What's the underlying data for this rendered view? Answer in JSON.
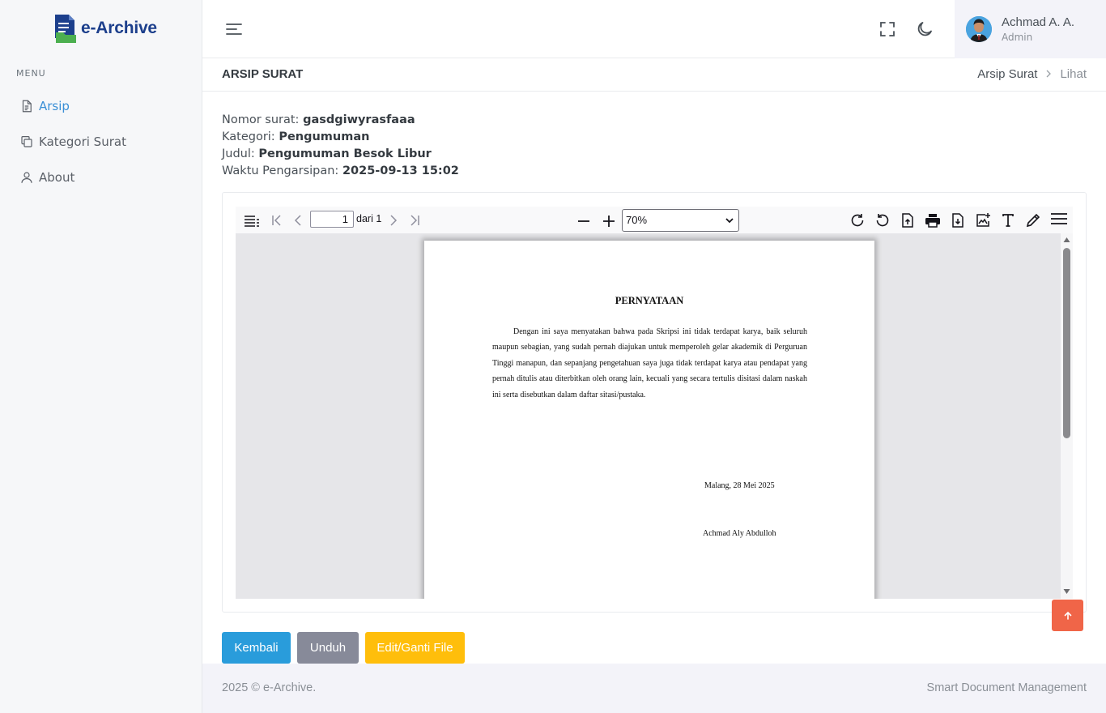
{
  "app": {
    "name": "e-Archive"
  },
  "sidebar": {
    "menu_title": "MENU",
    "items": [
      {
        "label": "Arsip",
        "icon": "document-icon",
        "active": true
      },
      {
        "label": "Kategori Surat",
        "icon": "copy-icon",
        "active": false
      },
      {
        "label": "About",
        "icon": "user-icon",
        "active": false
      }
    ]
  },
  "topbar": {
    "user_name": "Achmad A. A.",
    "user_role": "Admin"
  },
  "page": {
    "title": "ARSIP SURAT",
    "breadcrumb": [
      "Arsip Surat",
      "Lihat"
    ]
  },
  "meta": {
    "nomor_label": "Nomor surat:",
    "nomor_value": "gasdgiwyrasfaaa",
    "kategori_label": "Kategori:",
    "kategori_value": "Pengumuman",
    "judul_label": "Judul:",
    "judul_value": "Pengumuman Besok Libur",
    "waktu_label": "Waktu Pengarsipan:",
    "waktu_value": "2025-09-13 15:02"
  },
  "viewer": {
    "page_number": "1",
    "page_of": "dari 1",
    "zoom": "70%",
    "document": {
      "title": "PERNYATAAN",
      "body": "Dengan ini saya menyatakan bahwa pada Skripsi ini tidak terdapat karya, baik seluruh maupun sebagian, yang sudah pernah diajukan untuk memperoleh gelar akademik di Perguruan Tinggi manapun, dan sepanjang pengetahuan saya juga tidak terdapat karya atau pendapat yang pernah ditulis atau diterbitkan oleh orang lain, kecuali yang secara tertulis disitasi dalam naskah ini serta disebutkan dalam daftar sitasi/pustaka.",
      "place_date": "Malang, 28 Mei 2025",
      "signer": "Achmad Aly Abdulloh"
    }
  },
  "buttons": {
    "back": "Kembali",
    "download": "Unduh",
    "edit": "Edit/Ganti File"
  },
  "footer": {
    "left": "2025 © e-Archive.",
    "right": "Smart Document Management"
  },
  "colors": {
    "primary": "#299cdb",
    "secondary": "#878a99",
    "warning": "#ffbe0b",
    "danger": "#f06548",
    "brand": "#1c3f8c"
  }
}
